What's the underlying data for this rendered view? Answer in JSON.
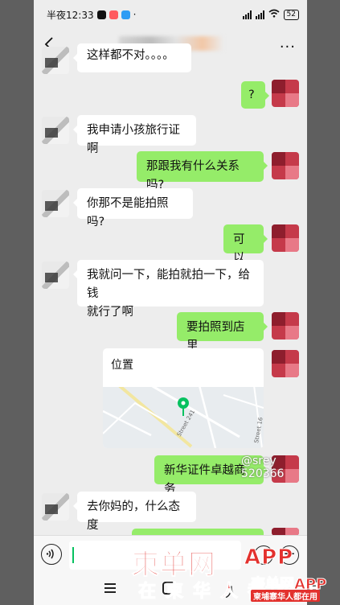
{
  "status_bar": {
    "time": "半夜12:33",
    "battery": "52"
  },
  "header": {
    "back_icon": "chevron-left-icon",
    "more_icon": "more-dots-icon",
    "more_label": "···"
  },
  "messages": [
    {
      "side": "in",
      "text": "这样都不对。。。。"
    },
    {
      "side": "out",
      "text": "?"
    },
    {
      "side": "in",
      "text": "我申请小孩旅行证啊"
    },
    {
      "side": "out",
      "text": "那跟我有什么关系吗?"
    },
    {
      "side": "in",
      "text": "你那不是能拍照吗?"
    },
    {
      "side": "out",
      "text": "可以"
    },
    {
      "side": "in",
      "text": "我就问一下，能拍就拍一下，给钱\n就行了啊"
    },
    {
      "side": "out",
      "text": "要拍照到店里"
    },
    {
      "side": "out",
      "text": "新华证件卓越商务"
    },
    {
      "side": "in",
      "text": "去你妈的，什么态度"
    }
  ],
  "location_card": {
    "title": "位置",
    "map_labels": [
      "Street 241",
      "Street 16"
    ]
  },
  "video_watermark": "@srey    520366",
  "input_bar": {
    "voice_icon": "voice-icon",
    "emoji_icon": "emoji-icon",
    "plus_icon": "plus-icon",
    "plus_label": "+"
  },
  "nav_bar": {
    "menu_icon": "menu-icon",
    "home_icon": "home-icon",
    "back_label": "人"
  },
  "watermark": {
    "main": "柬单网",
    "sub": "在柬华人都在用",
    "app": "APP",
    "app_line2": "柬单网APP",
    "slogan": "柬埔寨华人都在用"
  }
}
